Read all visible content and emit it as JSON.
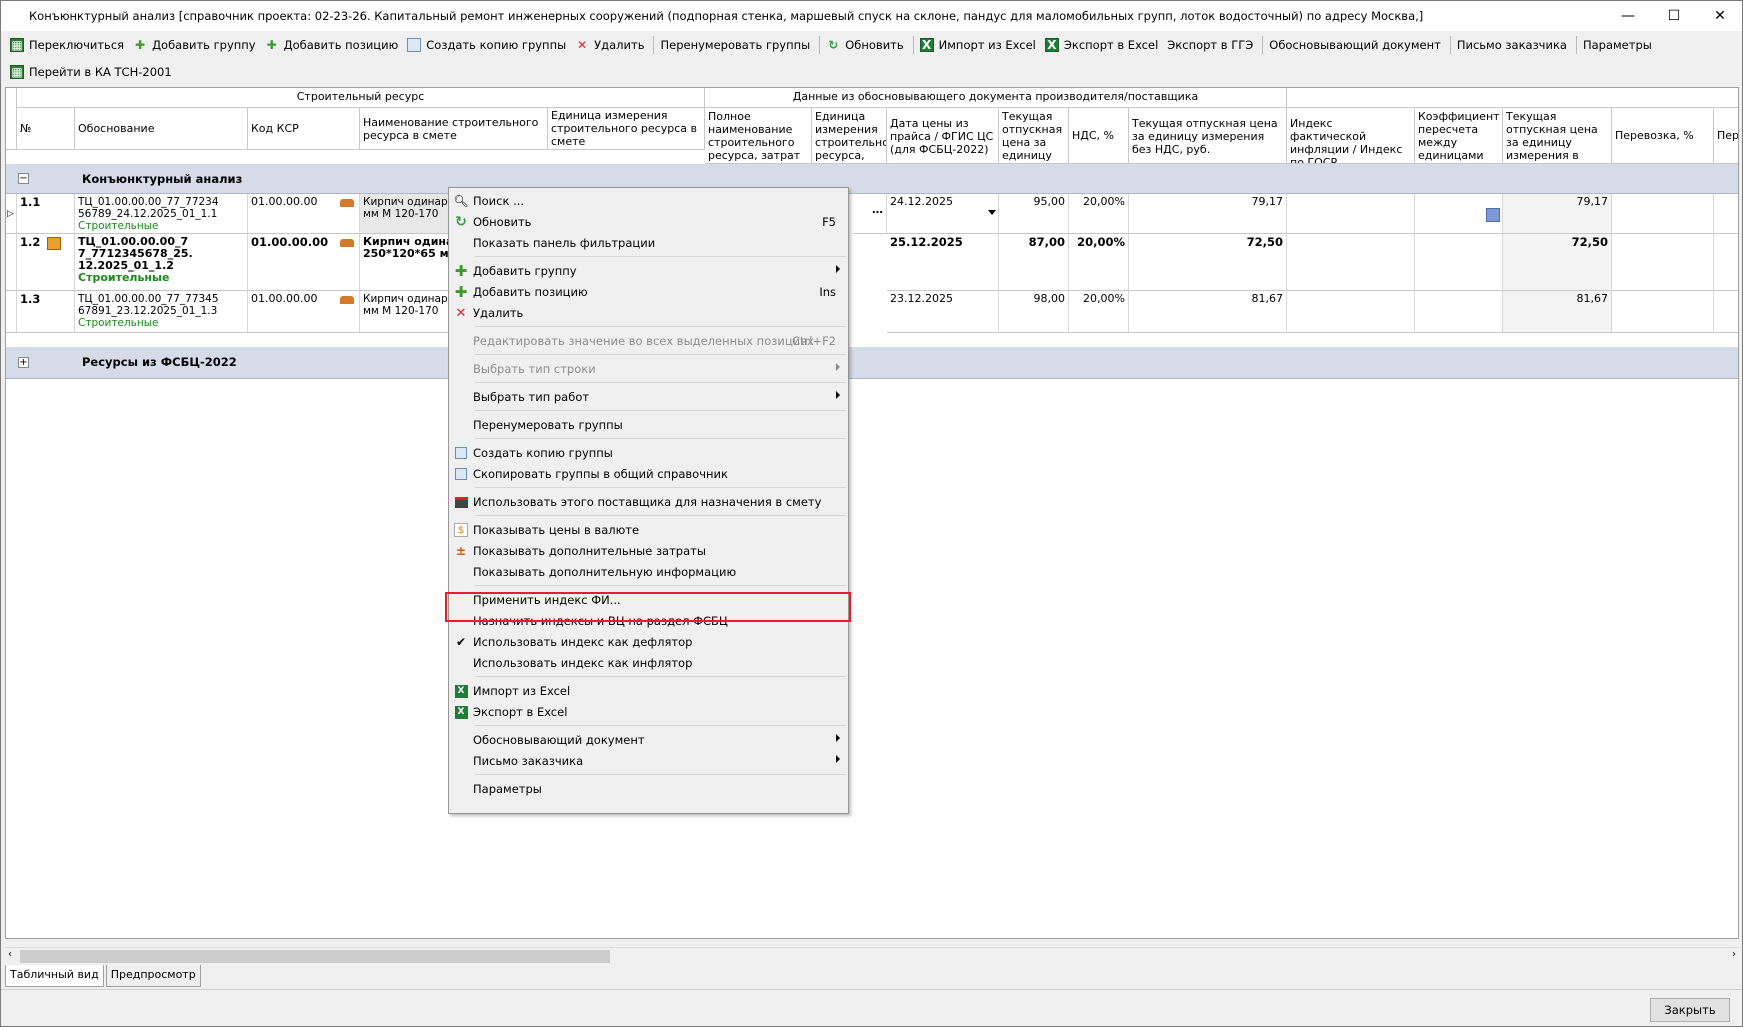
{
  "window": {
    "title": "Конъюнктурный анализ [справочник проекта: 02-23-26. Капитальный ремонт инженерных сооружений (подпорная стенка, маршевый спуск на склоне, пандус для маломобильных групп, лоток водосточный) по адресу Москва,]",
    "minimize": "—",
    "maximize": "☐",
    "close": "✕"
  },
  "toolbar1": [
    {
      "id": "switch",
      "label": "Переключиться",
      "icon": "calculator-icon"
    },
    {
      "id": "add-group",
      "label": "Добавить группу",
      "icon": "plus-icon"
    },
    {
      "id": "add-position",
      "label": "Добавить позицию",
      "icon": "plus-icon"
    },
    {
      "id": "copy-group",
      "label": "Создать копию группы",
      "icon": "copy-icon"
    },
    {
      "id": "delete",
      "label": "Удалить",
      "icon": "delete-icon"
    },
    {
      "id": "renumber",
      "label": "Перенумеровать группы",
      "icon": ""
    },
    {
      "id": "refresh",
      "label": "Обновить",
      "icon": "refresh-icon"
    },
    {
      "id": "import-excel",
      "label": "Импорт из Excel",
      "icon": "excel-icon"
    },
    {
      "id": "export-excel",
      "label": "Экспорт в Excel",
      "icon": "excel-icon"
    },
    {
      "id": "export-gge",
      "label": "Экспорт в ГГЭ",
      "icon": ""
    },
    {
      "id": "justifying-doc",
      "label": "Обосновывающий документ",
      "icon": ""
    },
    {
      "id": "customer-letter",
      "label": "Письмо заказчика",
      "icon": ""
    },
    {
      "id": "params",
      "label": "Параметры",
      "icon": ""
    }
  ],
  "toolbar2": [
    {
      "id": "go-tsn",
      "label": "Перейти в КА ТСН-2001",
      "icon": "calculator-icon"
    }
  ],
  "table": {
    "band1": "Строительный ресурс",
    "band2": "Данные из обосновывающего документа производителя/поставщика",
    "columns": {
      "num": "№",
      "basis": "Обоснование",
      "ksr": "Код КСР",
      "name": "Наименование строительного ресурса в смете",
      "unit": "Единица измерения строительного ресурса в смете",
      "fullname": "Полное наименование строительного ресурса, затрат",
      "unit2": "Единица измерения строительног ресурса,",
      "date": "Дата цены из прайса / ФГИС ЦС (для ФСБЦ-2022)",
      "price": "Текущая отпускная цена за единицу",
      "vat": "НДС, %",
      "price_novat": "Текущая отпускная цена за единицу измерения без НДС, руб.",
      "index": "Индекс фактической инфляции / Индекс по ГОСР",
      "coef": "Коэффициент пересчета между единицами",
      "price_est": "Текущая отпускная цена за единицу измерения в смете без НДС, руб.",
      "transport": "Перевозка, %",
      "extra": "Пере"
    },
    "group1": {
      "expander": "−",
      "label": "Конъюнктурный анализ"
    },
    "group2": {
      "expander": "+",
      "label": "Ресурсы из ФСБЦ-2022"
    },
    "rows": [
      {
        "num": "1.1",
        "basis1": "ТЦ_01.00.00.00_77_77234",
        "basis2": "56789_24.12.2025_01_1.1",
        "basis3": "Строительные",
        "ksr": "01.00.00.00",
        "name1": "Кирпич одинарн",
        "name2": "мм М 120-170",
        "date": "24.12.2025",
        "price": "95,00",
        "vat": "20,00%",
        "price_novat": "79,17",
        "price_est": "79,17",
        "dots": "…"
      },
      {
        "num": "1.2",
        "basis1": "ТЦ_01.00.00.00_7",
        "basis2": "7_7712345678_25.",
        "basis3": "12.2025_01_1.2",
        "basis4": "Строительные",
        "ksr": "01.00.00.00",
        "name1": "Кирпич одина",
        "name2": "250*120*65 м",
        "date": "25.12.2025",
        "price": "87,00",
        "vat": "20,00%",
        "price_novat": "72,50",
        "price_est": "72,50"
      },
      {
        "num": "1.3",
        "basis1": "ТЦ_01.00.00.00_77_77345",
        "basis2": "67891_23.12.2025_01_1.3",
        "basis3": "Строительные",
        "ksr": "01.00.00.00",
        "name1": "Кирпич одинарн",
        "name2": "мм М 120-170",
        "date": "23.12.2025",
        "price": "98,00",
        "vat": "20,00%",
        "price_novat": "81,67",
        "price_est": "81,67"
      }
    ]
  },
  "context_menu": {
    "search": "Поиск ...",
    "refresh": "Обновить",
    "refresh_sc": "F5",
    "filter_panel": "Показать панель фильтрации",
    "add_group": "Добавить группу",
    "add_position": "Добавить позицию",
    "add_position_sc": "Ins",
    "delete": "Удалить",
    "edit_all": "Редактировать значение во всех выделенных позициях",
    "edit_all_sc": "Ctrl+F2",
    "row_type": "Выбрать тип строки",
    "work_type": "Выбрать тип работ",
    "renumber": "Перенумеровать группы",
    "copy_group": "Создать копию группы",
    "copy_to_common": "Скопировать группы в общий справочник",
    "use_supplier": "Использовать этого поставщика для назначения в смету",
    "show_currency": "Показывать цены в валюте",
    "show_extra_costs": "Показывать дополнительные затраты",
    "show_extra_info": "Показывать дополнительную информацию",
    "apply_index": "Применить индекс ФИ...",
    "assign_indexes": "Назначить индексы и ВЦ на раздел ФСБЦ",
    "use_deflator": "Использовать индекс как дефлятор",
    "use_inflator": "Использовать индекс как инфлятор",
    "import_excel": "Импорт из Excel",
    "export_excel": "Экспорт в Excel",
    "justifying_doc": "Обосновывающий документ",
    "customer_letter": "Письмо заказчика",
    "params": "Параметры"
  },
  "tabs": {
    "table": "Табличный вид",
    "preview": "Предпросмотр"
  },
  "footer": {
    "close": "Закрыть"
  },
  "colors": {
    "group_bg": "#d5dbe8",
    "highlight": "#e3202a",
    "green_text": "#1a8a1a"
  }
}
